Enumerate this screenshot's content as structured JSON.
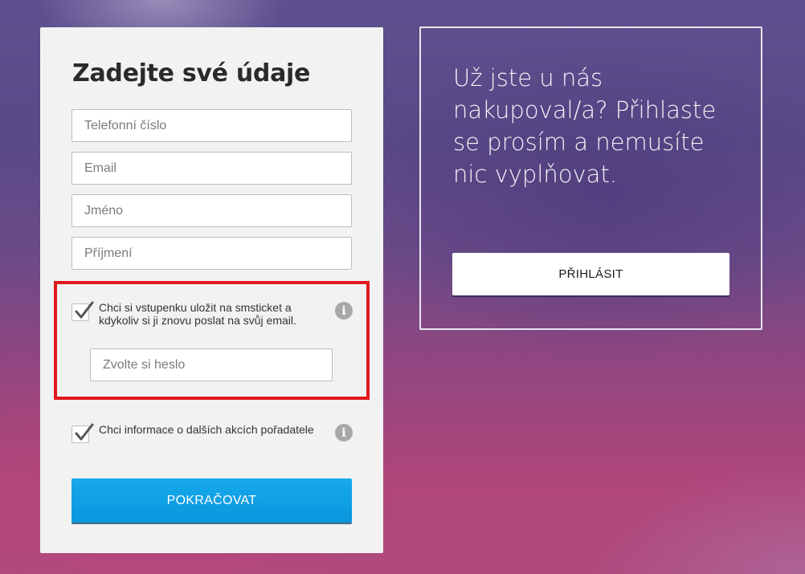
{
  "form": {
    "title": "Zadejte své údaje",
    "fields": {
      "phone": {
        "placeholder": "Telefonní číslo",
        "value": ""
      },
      "email": {
        "placeholder": "Email",
        "value": ""
      },
      "first_name": {
        "placeholder": "Jméno",
        "value": ""
      },
      "last_name": {
        "placeholder": "Příjmení",
        "value": ""
      }
    },
    "save_ticket": {
      "checked": true,
      "label": "Chci si vstupenku uložit na smsticket a kdykoliv si ji znovu poslat na svůj email.",
      "info_icon": "info-icon",
      "password_placeholder": "Zvolte si heslo",
      "password_value": ""
    },
    "newsletter": {
      "checked": true,
      "label": "Chci informace o dalších akcích pořadatele",
      "info_icon": "info-icon"
    },
    "submit_label": "POKRAČOVAT"
  },
  "login": {
    "prompt": "Už jste u nás nakupoval/a? Přihlaste se prosím a nemusíte nic vyplňovat.",
    "button_label": "PŘIHLÁSIT"
  },
  "colors": {
    "accent_blue": "#0a9be0",
    "highlight_red": "#e0191d",
    "panel_bg": "#f2f2f2"
  }
}
